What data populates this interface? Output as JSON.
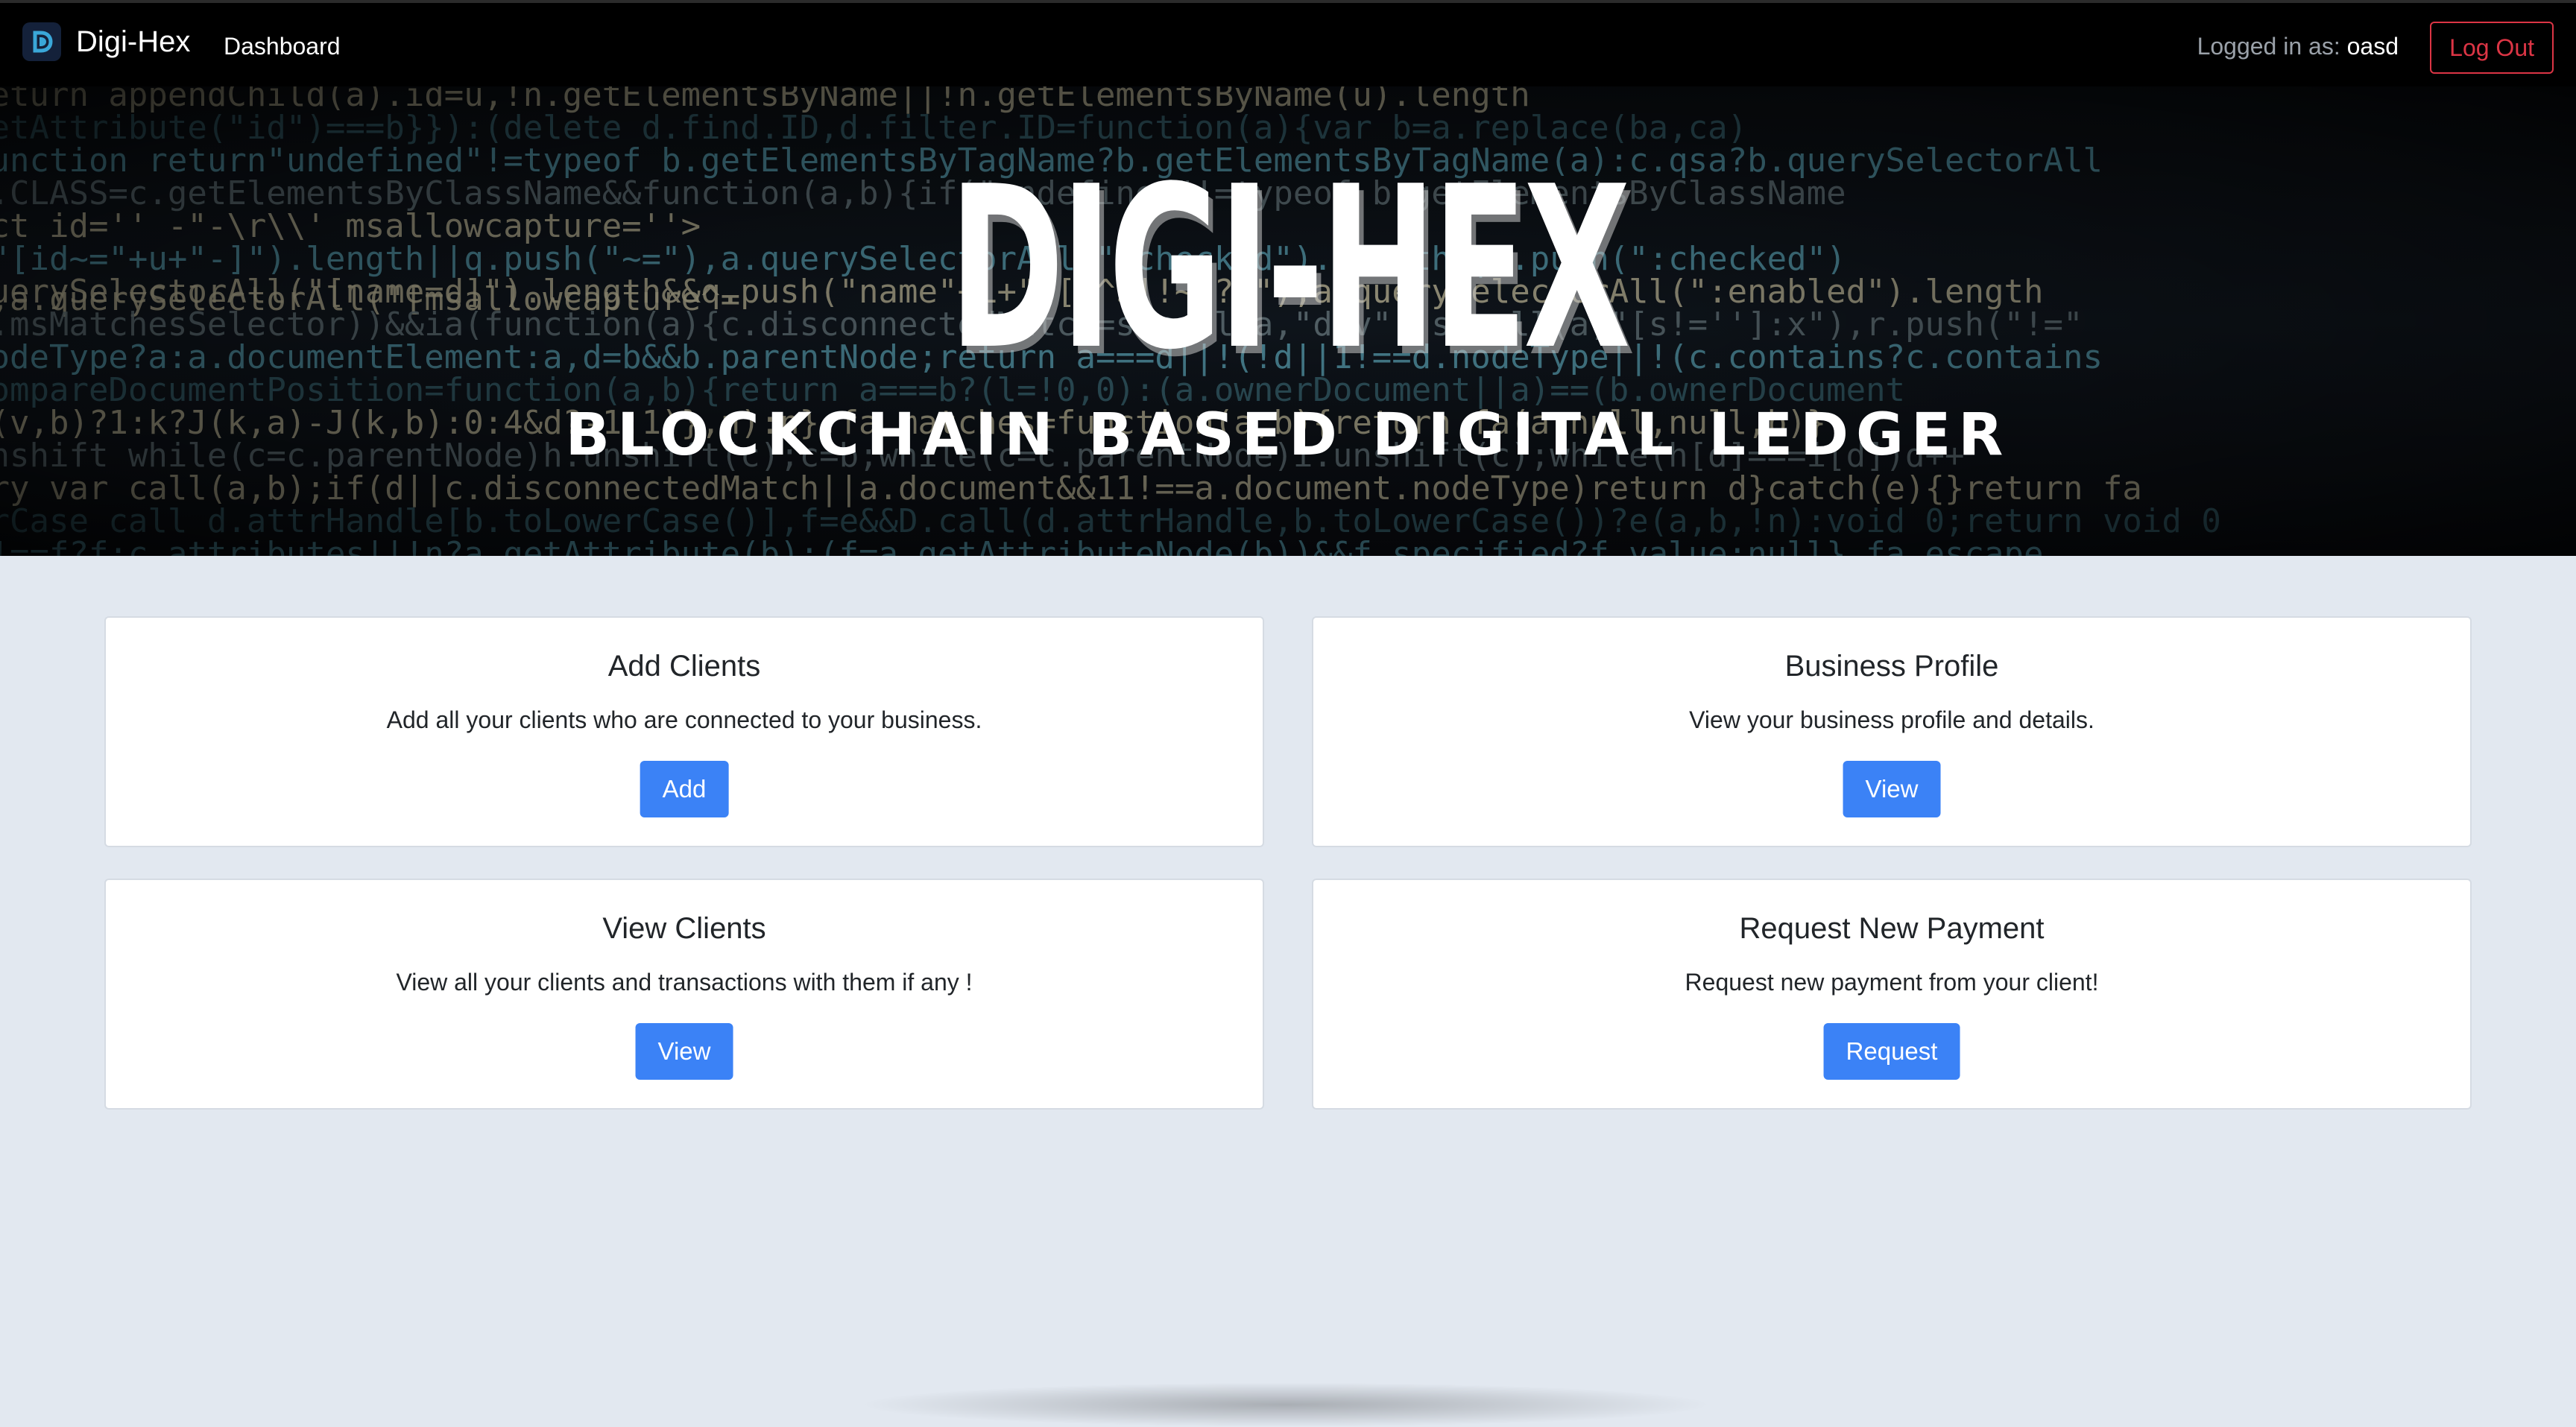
{
  "navbar": {
    "brand_logo_letter": "D",
    "brand": "Digi-Hex",
    "nav_link": "Dashboard",
    "login_label": "Logged in as:",
    "username": "oasd",
    "logout_label": "Log Out"
  },
  "hero": {
    "title": "DIGI-HEX",
    "subtitle": "BLOCKCHAIN BASED DIGITAL LEDGER"
  },
  "cards": [
    {
      "title": "Add Clients",
      "text": "Add all your clients who are connected to your business.",
      "button": "Add"
    },
    {
      "title": "Business Profile",
      "text": "View your business profile and details.",
      "button": "View"
    },
    {
      "title": "View Clients",
      "text": "View all your clients and transactions with them if any !",
      "button": "View"
    },
    {
      "title": "Request New Payment",
      "text": "Request new payment from your client!",
      "button": "Request"
    }
  ],
  "colors": {
    "primary": "#3b82f6",
    "danger": "#dc3545",
    "page_bg": "#e2e8f0",
    "navbar_bg": "#000000"
  }
}
